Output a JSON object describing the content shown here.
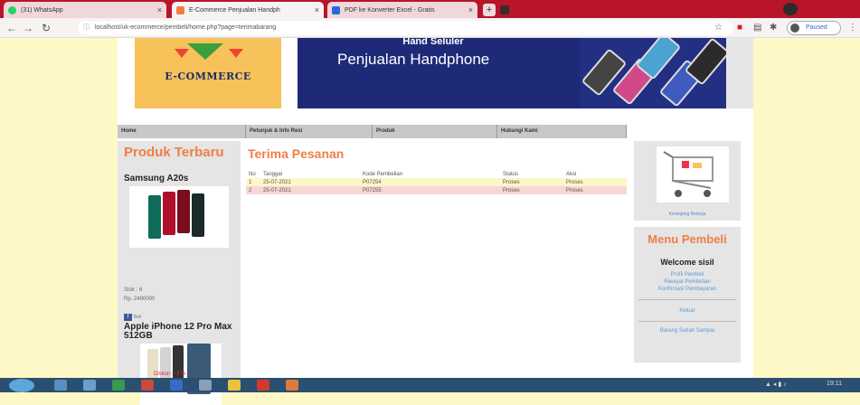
{
  "browser": {
    "tabs": [
      {
        "title": "(31) WhatsApp",
        "active": false
      },
      {
        "title": "E-Commerce Penjualan Handph",
        "active": true
      },
      {
        "title": "PDF ke Konverter Excel - Gratis",
        "active": false
      }
    ],
    "url": "localhost/uk-ecommerce/pembeli/home.php?page=terimabarang",
    "profile_label": "Paused"
  },
  "banner": {
    "logo_text": "E-COMMERCE",
    "subtitle_partial": "Hand Seluler",
    "title": "Penjualan Handphone"
  },
  "nav": {
    "items": [
      "Home",
      "Petunjuk & Info Resi",
      "Produk",
      "Hubungi Kami"
    ]
  },
  "sidebar_left": {
    "title": "Produk Terbaru",
    "products": [
      {
        "name": "Samsung A20s",
        "stock": "Stok : 6",
        "price": "Rp. 2490000",
        "button": "Beli"
      },
      {
        "name": "Apple iPhone 12 Pro Max 512GB",
        "discount": "Diskon = 3 %"
      }
    ]
  },
  "main": {
    "title": "Terima Pesanan",
    "table": {
      "headers": [
        "No",
        "Tanggal",
        "Kode Pembelian",
        "Status",
        "Aksi"
      ],
      "rows": [
        [
          "1",
          "25-07-2021",
          "P07254",
          "Proses",
          "Proses"
        ],
        [
          "2",
          "25-07-2021",
          "P07255",
          "Proses",
          "Proses"
        ]
      ]
    }
  },
  "sidebar_right": {
    "cart_label": "Keranjang Belanja",
    "menu_title": "Menu Pembeli",
    "welcome": "Welcome sisil",
    "links": [
      "Profil Pembeli",
      "Riwayat Pembelian",
      "Konfirmasi Pembayaran"
    ],
    "logout": "Keluar",
    "received": "Barang Sudah Sampai"
  },
  "taskbar": {
    "time": "19:11"
  },
  "colors": {
    "accent_orange": "#f07e44",
    "page_bg": "#fdf8c5",
    "banner_blue": "#1e2a78",
    "tab_strip": "#b8152a"
  }
}
